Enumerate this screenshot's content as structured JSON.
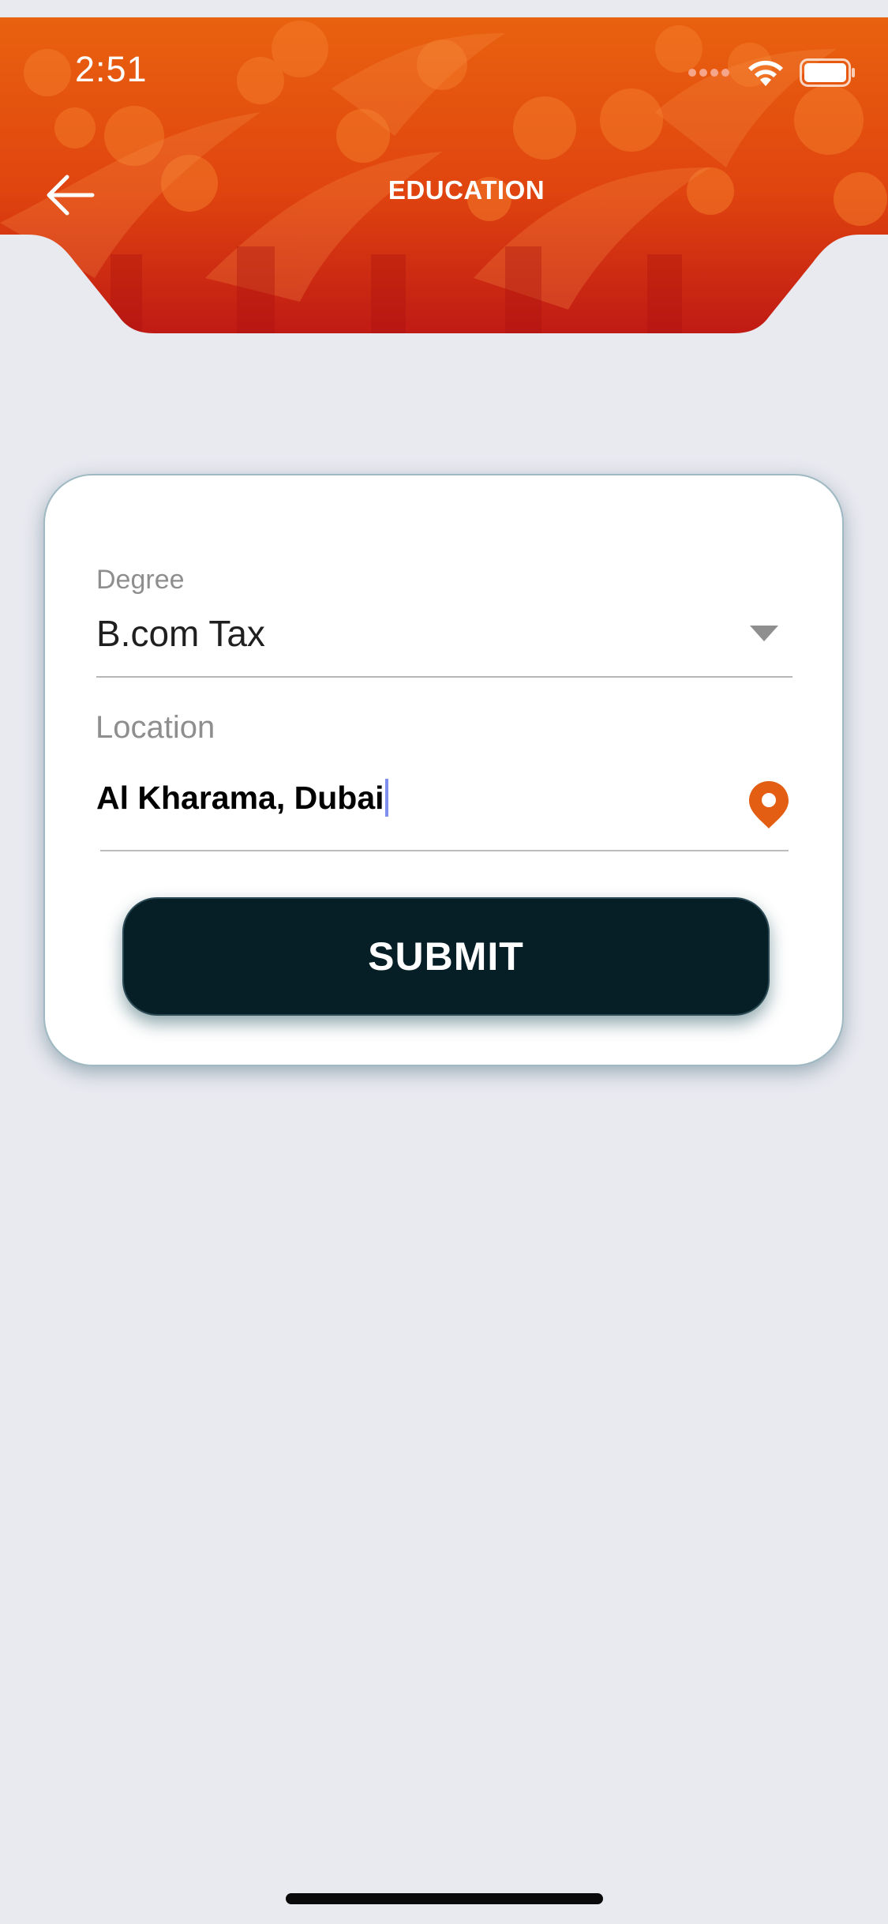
{
  "status_bar": {
    "time": "2:51"
  },
  "header": {
    "title": "EDUCATION"
  },
  "form": {
    "degree": {
      "label": "Degree",
      "value": "B.com Tax"
    },
    "location": {
      "label": "Location",
      "value": "Al Kharama, Dubai"
    },
    "submit_label": "SUBMIT"
  },
  "colors": {
    "header_orange": "#e8570f",
    "header_red": "#c21c14",
    "accent_pin": "#e35e12",
    "button_bg": "#061f26",
    "page_bg": "#e9e9f0"
  },
  "icons": {
    "back": "arrow-left-icon",
    "dropdown": "chevron-down-icon",
    "location": "location-pin-icon",
    "signal": "cellular-signal-icon",
    "wifi": "wifi-icon",
    "battery": "battery-icon"
  }
}
